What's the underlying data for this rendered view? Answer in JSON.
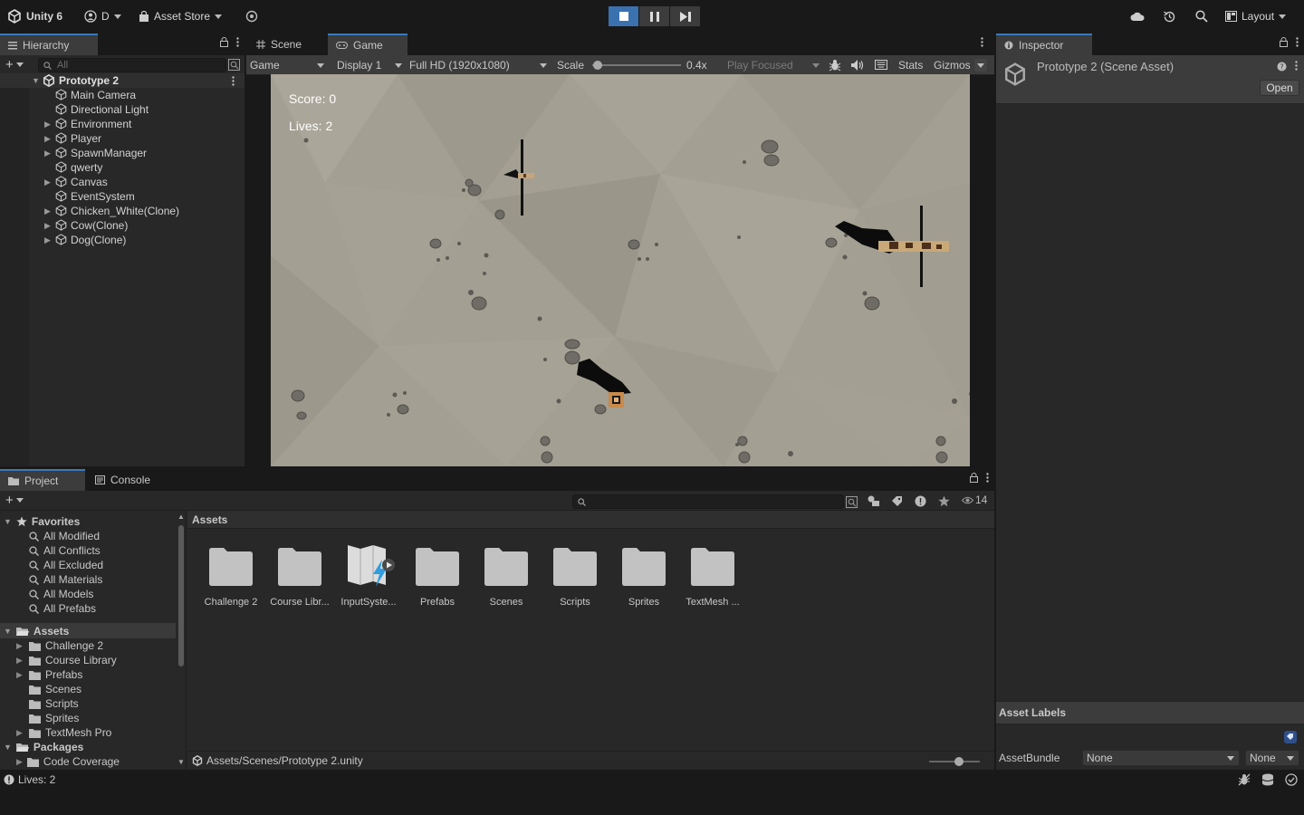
{
  "toolbar": {
    "app_name": "Unity 6",
    "account_label": "D",
    "asset_store_label": "Asset Store",
    "layout_label": "Layout"
  },
  "hierarchy": {
    "tab_label": "Hierarchy",
    "search_placeholder": "All",
    "scene_name": "Prototype 2",
    "items": [
      {
        "label": "Main Camera",
        "expandable": false
      },
      {
        "label": "Directional Light",
        "expandable": false
      },
      {
        "label": "Environment",
        "expandable": true
      },
      {
        "label": "Player",
        "expandable": true
      },
      {
        "label": "SpawnManager",
        "expandable": true
      },
      {
        "label": "qwerty",
        "expandable": false
      },
      {
        "label": "Canvas",
        "expandable": true
      },
      {
        "label": "EventSystem",
        "expandable": false
      },
      {
        "label": "Chicken_White(Clone)",
        "expandable": true
      },
      {
        "label": "Cow(Clone)",
        "expandable": true
      },
      {
        "label": "Dog(Clone)",
        "expandable": true
      }
    ]
  },
  "center_tabs": {
    "scene_label": "Scene",
    "game_label": "Game"
  },
  "game_toolbar": {
    "view_mode": "Game",
    "display": "Display 1",
    "resolution": "Full HD (1920x1080)",
    "scale_label": "Scale",
    "scale_value": "0.4x",
    "scale_level": 0.02,
    "play_focused": "Play Focused",
    "stats_label": "Stats",
    "gizmos_label": "Gizmos"
  },
  "game_hud": {
    "score_text": "Score: 0",
    "lives_text": "Lives: 2"
  },
  "inspector": {
    "tab_label": "Inspector",
    "asset_title": "Prototype 2 (Scene Asset)",
    "open_button": "Open",
    "asset_labels_title": "Asset Labels",
    "assetbundle_label": "AssetBundle",
    "assetbundle_value": "None",
    "assetbundle_variant": "None"
  },
  "project": {
    "tab_project": "Project",
    "tab_console": "Console",
    "hidden_count": "14",
    "favorites_title": "Favorites",
    "favorites": [
      "All Modified",
      "All Conflicts",
      "All Excluded",
      "All Materials",
      "All Models",
      "All Prefabs"
    ],
    "assets_root": "Assets",
    "asset_folders": [
      {
        "label": "Challenge 2",
        "expandable": true
      },
      {
        "label": "Course Library",
        "expandable": true
      },
      {
        "label": "Prefabs",
        "expandable": true
      },
      {
        "label": "Scenes",
        "expandable": false
      },
      {
        "label": "Scripts",
        "expandable": false
      },
      {
        "label": "Sprites",
        "expandable": false
      },
      {
        "label": "TextMesh Pro",
        "expandable": true
      }
    ],
    "packages_root": "Packages",
    "packages": [
      {
        "label": "Code Coverage"
      }
    ],
    "breadcrumb": "Assets",
    "grid_items": [
      "Challenge 2",
      "Course Libr...",
      "InputSyste...",
      "Prefabs",
      "Scenes",
      "Scripts",
      "Sprites",
      "TextMesh ..."
    ],
    "selected_path": "Assets/Scenes/Prototype 2.unity"
  },
  "status_bar": {
    "message": "Lives: 2"
  },
  "colors": {
    "accent": "#3a79bb",
    "panel_bg": "#282828",
    "toolbar_bg": "#191919",
    "game_ground": "#a39f92"
  }
}
